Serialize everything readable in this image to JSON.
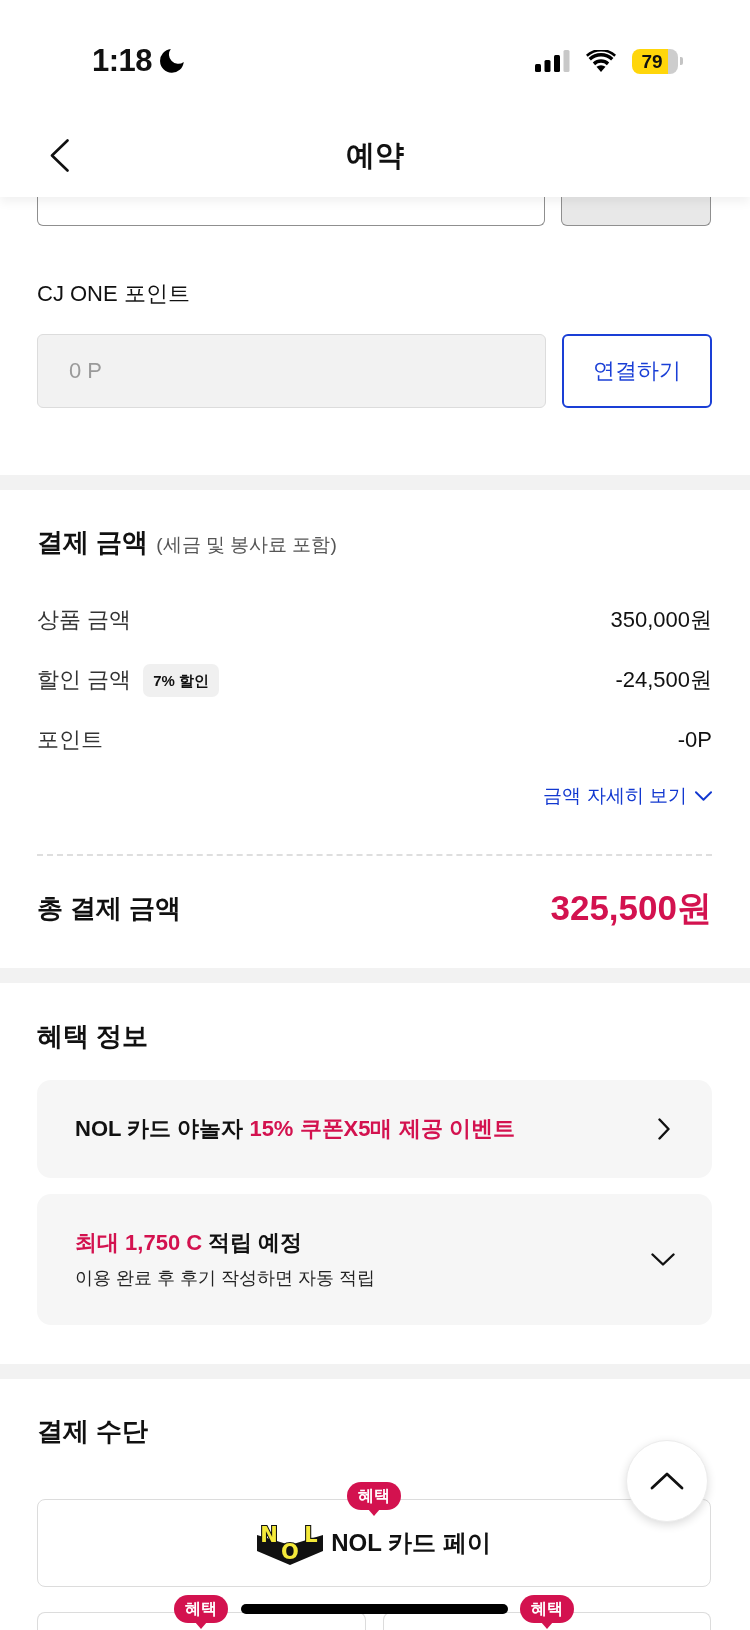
{
  "status_bar": {
    "time": "1:18",
    "battery": "79"
  },
  "header": {
    "title": "예약"
  },
  "cj_one": {
    "label": "CJ ONE 포인트",
    "field": {
      "placeholder": "0 P",
      "disabled": true
    },
    "button": "연결하기"
  },
  "payment_amount": {
    "title": "결제 금액",
    "note": "(세금 및 봉사료 포함)",
    "rows": [
      {
        "label": "상품 금액",
        "value": "350,000원"
      },
      {
        "label": "할인 금액",
        "badge": "7% 할인",
        "value": "-24,500원"
      },
      {
        "label": "포인트",
        "value": "-0P"
      }
    ],
    "details_link": {
      "label": "금액 자세히 보기",
      "expanded": false
    },
    "total": {
      "label": "총 결제 금액",
      "value": "325,500원"
    }
  },
  "benefits": {
    "title": "혜택 정보",
    "items": [
      {
        "kind": "link",
        "parts": [
          {
            "text": "NOL 카드 야놀자",
            "accent": false
          },
          {
            "text": "15% 쿠폰X5매 제공 이벤트",
            "accent": true
          }
        ]
      },
      {
        "kind": "expandable",
        "expanded": false,
        "parts": [
          {
            "text": "최대 1,750 C",
            "accent": true
          },
          {
            "text": "적립 예정",
            "accent": false
          }
        ],
        "description": "이용 완료 후 후기 작성하면 자동 적립"
      }
    ]
  },
  "payment_methods": {
    "title": "결제 수단",
    "options": [
      {
        "kind": "wide",
        "logo": "NOL",
        "label": "NOL 카드 페이",
        "badge": "혜택"
      },
      {
        "kind": "half",
        "badge": "혜택"
      },
      {
        "kind": "half",
        "badge": "혜택"
      }
    ]
  }
}
